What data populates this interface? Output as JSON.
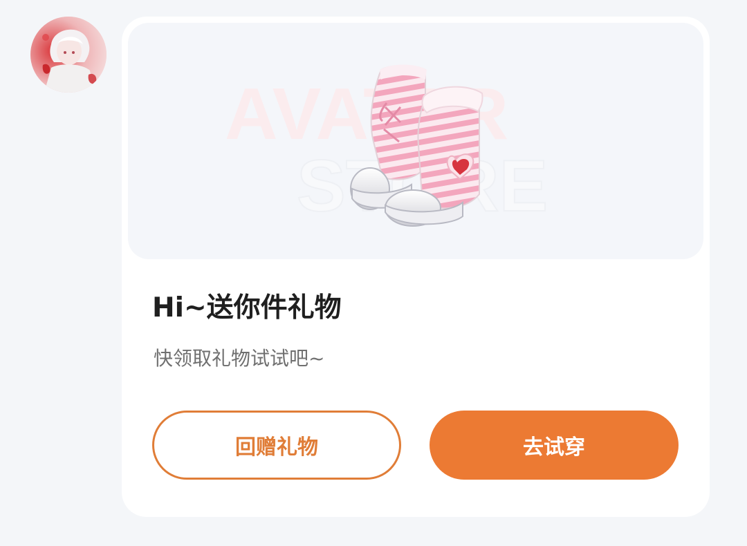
{
  "message": {
    "sender_avatar_icon": "user-avatar",
    "card": {
      "image_icon": "pink-striped-boots",
      "watermark": {
        "line1": "AVATAR",
        "line2": "STORE"
      },
      "title": "Hi~送你件礼物",
      "subtitle": "快领取礼物试试吧~",
      "buttons": {
        "return_gift_label": "回赠礼物",
        "try_on_label": "去试穿"
      }
    }
  },
  "colors": {
    "accent": "#ec7a33",
    "accent_outline": "#e07d37",
    "background": "#f4f6f9",
    "card": "#ffffff"
  }
}
